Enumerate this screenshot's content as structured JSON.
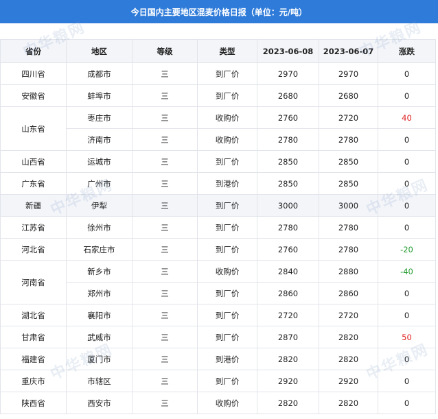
{
  "title": "今日国内主要地区混麦价格日报（单位：元/吨）",
  "watermark": "中华粮网",
  "colors": {
    "header_bg": "#2f7bd9",
    "up": "#e02020",
    "down": "#1f9b2c"
  },
  "columns": [
    "省份",
    "地区",
    "等级",
    "类型",
    "2023-06-08",
    "2023-06-07",
    "涨跌"
  ],
  "rows": [
    {
      "province": "四川省",
      "region": "成都市",
      "grade": "三",
      "type": "到厂价",
      "d1": "2970",
      "d2": "2970",
      "change": "0"
    },
    {
      "province": "安徽省",
      "region": "蚌埠市",
      "grade": "三",
      "type": "到厂价",
      "d1": "2680",
      "d2": "2680",
      "change": "0"
    },
    {
      "province": "山东省",
      "region": "枣庄市",
      "grade": "三",
      "type": "收购价",
      "d1": "2760",
      "d2": "2720",
      "change": "40"
    },
    {
      "province": "",
      "region": "济南市",
      "grade": "三",
      "type": "收购价",
      "d1": "2780",
      "d2": "2780",
      "change": "0"
    },
    {
      "province": "山西省",
      "region": "运城市",
      "grade": "三",
      "type": "到厂价",
      "d1": "2850",
      "d2": "2850",
      "change": "0"
    },
    {
      "province": "广东省",
      "region": "广州市",
      "grade": "三",
      "type": "到港价",
      "d1": "2850",
      "d2": "2850",
      "change": "0"
    },
    {
      "province": "新疆",
      "region": "伊犁",
      "grade": "三",
      "type": "到厂价",
      "d1": "3000",
      "d2": "3000",
      "change": "0"
    },
    {
      "province": "江苏省",
      "region": "徐州市",
      "grade": "三",
      "type": "到厂价",
      "d1": "2780",
      "d2": "2780",
      "change": "0"
    },
    {
      "province": "河北省",
      "region": "石家庄市",
      "grade": "三",
      "type": "到厂价",
      "d1": "2760",
      "d2": "2780",
      "change": "-20"
    },
    {
      "province": "河南省",
      "region": "新乡市",
      "grade": "三",
      "type": "收购价",
      "d1": "2840",
      "d2": "2880",
      "change": "-40"
    },
    {
      "province": "",
      "region": "郑州市",
      "grade": "三",
      "type": "到厂价",
      "d1": "2860",
      "d2": "2860",
      "change": "0"
    },
    {
      "province": "湖北省",
      "region": "襄阳市",
      "grade": "三",
      "type": "到厂价",
      "d1": "2720",
      "d2": "2720",
      "change": "0"
    },
    {
      "province": "甘肃省",
      "region": "武威市",
      "grade": "三",
      "type": "到厂价",
      "d1": "2870",
      "d2": "2820",
      "change": "50"
    },
    {
      "province": "福建省",
      "region": "厦门市",
      "grade": "三",
      "type": "到港价",
      "d1": "2820",
      "d2": "2820",
      "change": "0"
    },
    {
      "province": "重庆市",
      "region": "市辖区",
      "grade": "三",
      "type": "到厂价",
      "d1": "2920",
      "d2": "2920",
      "change": "0"
    },
    {
      "province": "陕西省",
      "region": "西安市",
      "grade": "三",
      "type": "收购价",
      "d1": "2820",
      "d2": "2820",
      "change": "0"
    }
  ]
}
